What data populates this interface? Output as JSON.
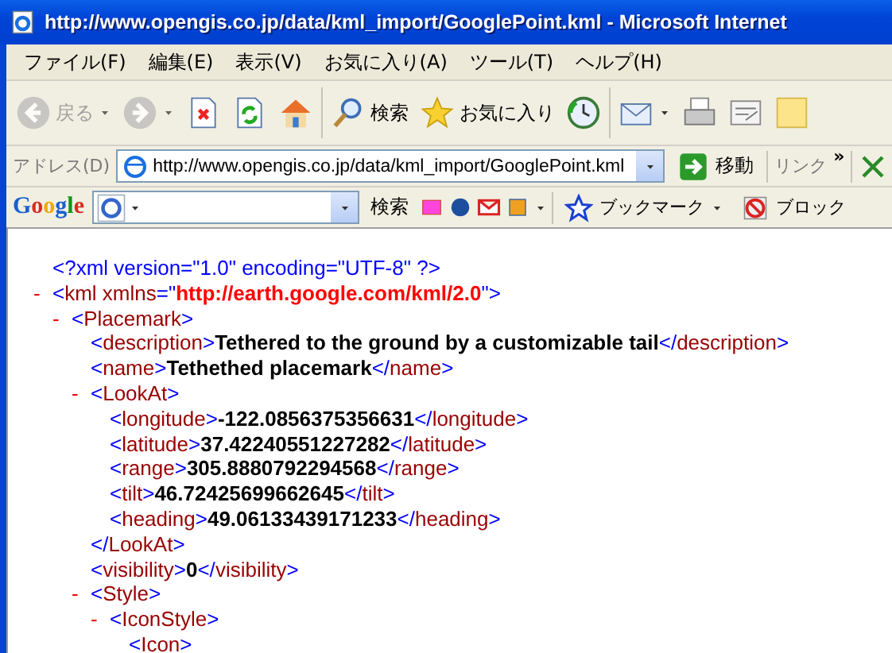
{
  "window": {
    "title": "http://www.opengis.co.jp/data/kml_import/GooglePoint.kml - Microsoft Internet"
  },
  "menu": [
    "ファイル(F)",
    "編集(E)",
    "表示(V)",
    "お気に入り(A)",
    "ツール(T)",
    "ヘルプ(H)"
  ],
  "toolbar": [
    {
      "kind": "back",
      "label": "戻る",
      "disabled": true,
      "dropdown": true
    },
    {
      "kind": "forward",
      "disabled": true,
      "dropdown": true
    },
    {
      "kind": "stop",
      "disabled": false
    },
    {
      "kind": "refresh",
      "disabled": false
    },
    {
      "kind": "home",
      "disabled": false
    },
    {
      "kind": "search",
      "label": "検索",
      "disabled": false
    },
    {
      "kind": "favorites",
      "label": "お気に入り",
      "disabled": false
    },
    {
      "kind": "history",
      "disabled": false
    },
    {
      "kind": "mail",
      "disabled": false,
      "dropdown": true
    },
    {
      "kind": "print",
      "disabled": false
    },
    {
      "kind": "edit",
      "disabled": false
    },
    {
      "kind": "note",
      "disabled": false
    }
  ],
  "address": {
    "label": "アドレス(D)",
    "value": "http://www.opengis.co.jp/data/kml_import/GooglePoint.kml",
    "go": "移動",
    "links": "リンク",
    "more": "»"
  },
  "google_bar": {
    "logo": "Google",
    "search": "検索",
    "bookmarks": "ブックマーク",
    "block": "ブロック"
  },
  "document": [
    {
      "kind": "pi",
      "text": "<?xml version=\"1.0\" encoding=\"UTF-8\" ?>"
    },
    {
      "kind": "element",
      "toggle": "-",
      "open": "<kml xmlns=\"",
      "attr_value": "http://earth.google.com/kml/2.0",
      "open_end": "\">",
      "children": [
        {
          "kind": "element",
          "toggle": "-",
          "open": "<Placemark>",
          "children": [
            {
              "kind": "leaf",
              "open": "<description>",
              "value": "Tethered to the ground by a customizable tail",
              "close": "</description>"
            },
            {
              "kind": "leaf",
              "open": "<name>",
              "value": "Tethethed placemark",
              "close": "</name>"
            },
            {
              "kind": "element",
              "toggle": "-",
              "open": "<LookAt>",
              "close": "</LookAt>",
              "children": [
                {
                  "kind": "leaf",
                  "open": "<longitude>",
                  "value": "-122.0856375356631",
                  "close": "</longitude>"
                },
                {
                  "kind": "leaf",
                  "open": "<latitude>",
                  "value": "37.42240551227282",
                  "close": "</latitude>"
                },
                {
                  "kind": "leaf",
                  "open": "<range>",
                  "value": "305.8880792294568",
                  "close": "</range>"
                },
                {
                  "kind": "leaf",
                  "open": "<tilt>",
                  "value": "46.72425699662645",
                  "close": "</tilt>"
                },
                {
                  "kind": "leaf",
                  "open": "<heading>",
                  "value": "49.06133439171233",
                  "close": "</heading>"
                }
              ]
            },
            {
              "kind": "leaf",
              "open": "<visibility>",
              "value": "0",
              "close": "</visibility>"
            },
            {
              "kind": "element",
              "toggle": "-",
              "open": "<Style>",
              "children": [
                {
                  "kind": "element",
                  "toggle": "-",
                  "open": "<IconStyle>",
                  "children": [
                    {
                      "kind": "leaf",
                      "open": "<Icon>"
                    }
                  ]
                }
              ]
            }
          ]
        }
      ]
    }
  ]
}
